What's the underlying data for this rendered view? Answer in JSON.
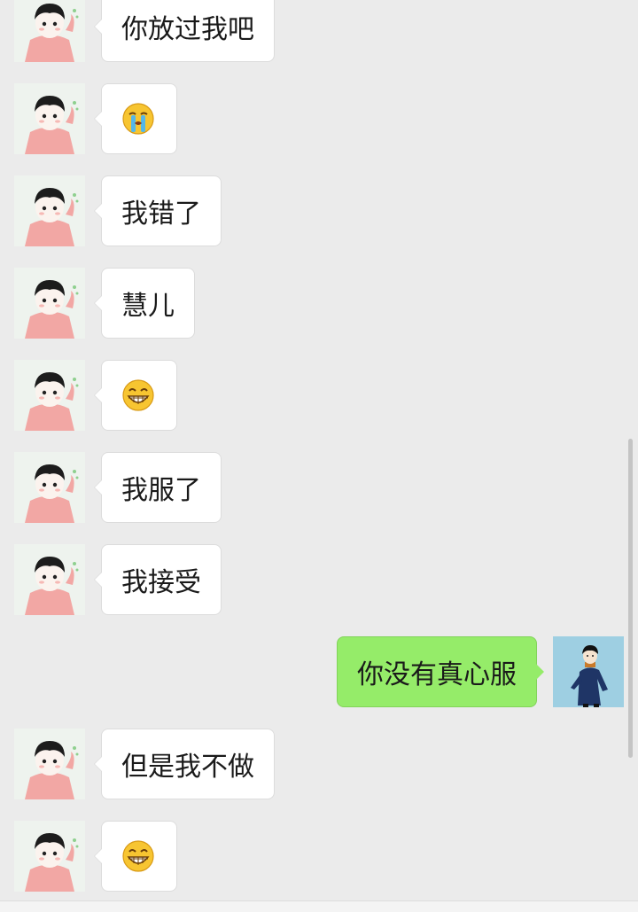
{
  "colors": {
    "background": "#ebebeb",
    "incoming_bubble": "#ffffff",
    "outgoing_bubble": "#95ec69"
  },
  "messages": [
    {
      "side": "left",
      "text": "你放过我吧"
    },
    {
      "side": "left",
      "emoji": "crying-emoji"
    },
    {
      "side": "left",
      "text": "我错了"
    },
    {
      "side": "left",
      "text": "慧儿"
    },
    {
      "side": "left",
      "emoji": "grinning-emoji"
    },
    {
      "side": "left",
      "text": "我服了"
    },
    {
      "side": "left",
      "text": "我接受"
    },
    {
      "side": "right",
      "text": "你没有真心服"
    },
    {
      "side": "left",
      "text": "但是我不做"
    },
    {
      "side": "left",
      "emoji": "grinning-emoji"
    }
  ]
}
